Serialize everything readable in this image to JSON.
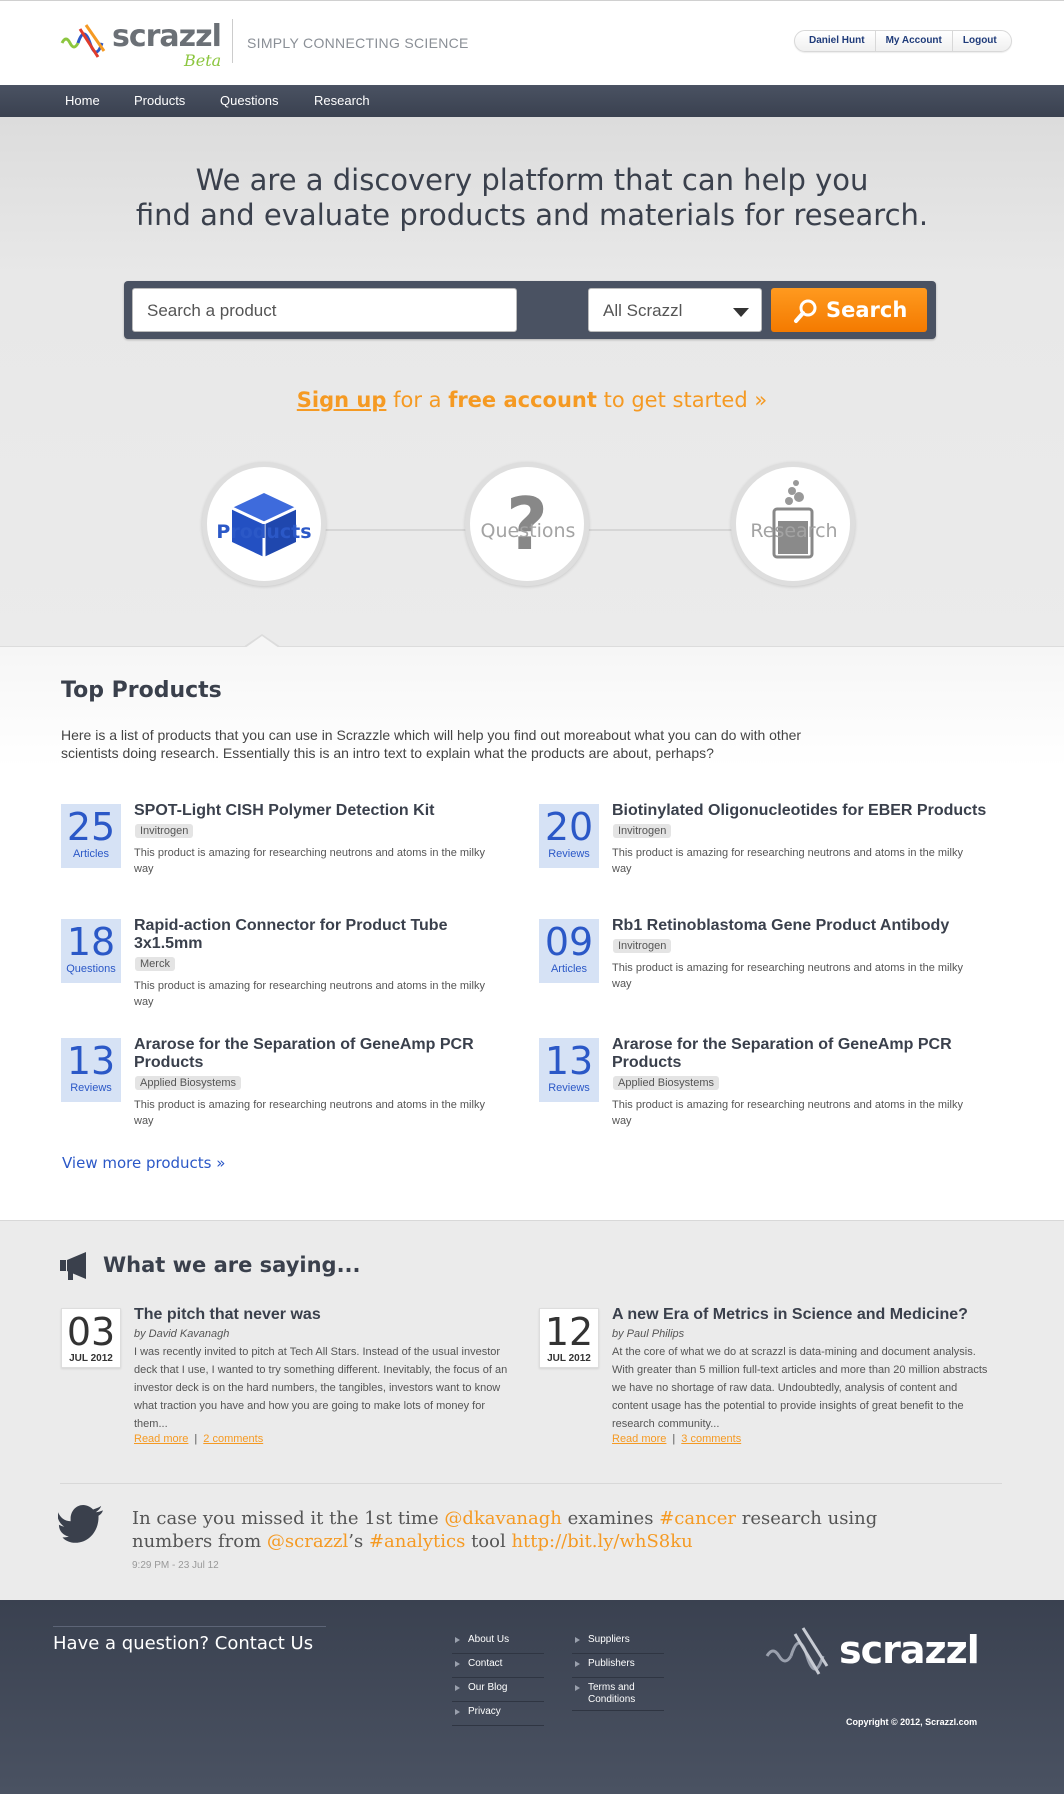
{
  "header": {
    "logo_text": "scrazzl",
    "logo_beta": "Beta",
    "tagline": "SIMPLY CONNECTING SCIENCE",
    "user_nav": [
      "Daniel Hunt",
      "My Account",
      "Logout"
    ]
  },
  "nav": [
    "Home",
    "Products",
    "Questions",
    "Research"
  ],
  "hero": {
    "headline_line1": "We are a discovery platform that can help you",
    "headline_line2": "find and evaluate products and materials for research.",
    "search_placeholder": "Search a product",
    "search_scope": "All Scrazzl",
    "search_button": "Search",
    "signup_link": "Sign up",
    "signup_mid": " for a ",
    "signup_free": "free account",
    "signup_end": " to get started »",
    "categories": [
      {
        "label": "Products",
        "icon": "cube-icon",
        "active": true
      },
      {
        "label": "Questions",
        "icon": "question-icon",
        "active": false
      },
      {
        "label": "Research",
        "icon": "beaker-icon",
        "active": false
      }
    ]
  },
  "top_products": {
    "title": "Top Products",
    "intro": "Here is a list of products that you can use in Scrazzle which will help you find out moreabout what you can do with other scientists doing research. Essentially this is an intro text to explain what the products are about, perhaps?",
    "items": [
      {
        "count": "25",
        "count_label": "Articles",
        "title": "SPOT-Light CISH Polymer Detection Kit",
        "vendor": "Invitrogen",
        "desc": "This product is amazing for researching neutrons and atoms in the milky way"
      },
      {
        "count": "20",
        "count_label": "Reviews",
        "title": "Biotinylated Oligonucleotides for EBER Products",
        "vendor": "Invitrogen",
        "desc": "This product is amazing for researching neutrons and atoms in the milky way"
      },
      {
        "count": "18",
        "count_label": "Questions",
        "title": "Rapid-action Connector for Product Tube 3x1.5mm",
        "vendor": "Merck",
        "desc": "This product is amazing for researching neutrons and atoms in the milky way"
      },
      {
        "count": "09",
        "count_label": "Articles",
        "title": "Rb1 Retinoblastoma Gene Product Antibody",
        "vendor": "Invitrogen",
        "desc": "This product is amazing for researching neutrons and atoms in the milky way"
      },
      {
        "count": "13",
        "count_label": "Reviews",
        "title": "Ararose for the Separation of GeneAmp PCR Products",
        "vendor": "Applied Biosystems",
        "desc": "This product is amazing for researching neutrons and atoms in the milky way"
      },
      {
        "count": "13",
        "count_label": "Reviews",
        "title": "Ararose for the Separation of GeneAmp PCR Products",
        "vendor": "Applied Biosystems",
        "desc": "This product is amazing for researching neutrons and atoms in the milky way"
      }
    ],
    "view_more": "View more products »"
  },
  "saying": {
    "title": "What we are saying...",
    "posts": [
      {
        "day": "03",
        "month": "JUL 2012",
        "title": "The pitch that never was",
        "author": "by David Kavanagh",
        "text": "I was recently invited to pitch at Tech All Stars. Instead of  the usual investor deck that I use, I wanted to try something different. Inevitably, the focus of an investor deck is on the hard numbers, the tangibles, investors want to know what traction you have and how you are going to make lots of money for them...",
        "read_more": "Read more",
        "comments": "2 comments"
      },
      {
        "day": "12",
        "month": "JUL 2012",
        "title": "A new Era of Metrics in Science and Medicine?",
        "author": "by Paul Philips",
        "text": "At the core of what we do at scrazzl is data-mining and document analysis. With greater than 5 million full-text articles and more than 20 million abstracts we have no shortage of raw data. Undoubtedly, analysis of content and content usage has the potential to provide insights of great benefit to the research community...",
        "read_more": "Read more",
        "comments": "3 comments"
      }
    ],
    "tweet": {
      "t1": "In case you missed it the 1st time ",
      "h1": "@dkavanagh",
      "t2": " examines ",
      "h2": "#cancer",
      "t3": " research using numbers from ",
      "h3": "@scrazzl",
      "t4": "’s ",
      "h4": "#analytics",
      "t5": " tool ",
      "h5": "http://bit.ly/whS8ku",
      "time": "9:29 PM - 23 Jul 12"
    }
  },
  "footer": {
    "question": "Have a question? Contact Us",
    "col1": [
      "About Us",
      "Contact",
      "Our Blog",
      "Privacy"
    ],
    "col2": [
      "Suppliers",
      "Publishers",
      "Terms and Conditions"
    ],
    "logo_text": "scrazzl",
    "copyright": "Copyright © 2012, Scrazzl.com"
  },
  "colors": {
    "brand_orange": "#f59a23",
    "brand_blue": "#2b58c7",
    "nav_bg": "#4a5262",
    "logo_green": "#8cc63f"
  }
}
